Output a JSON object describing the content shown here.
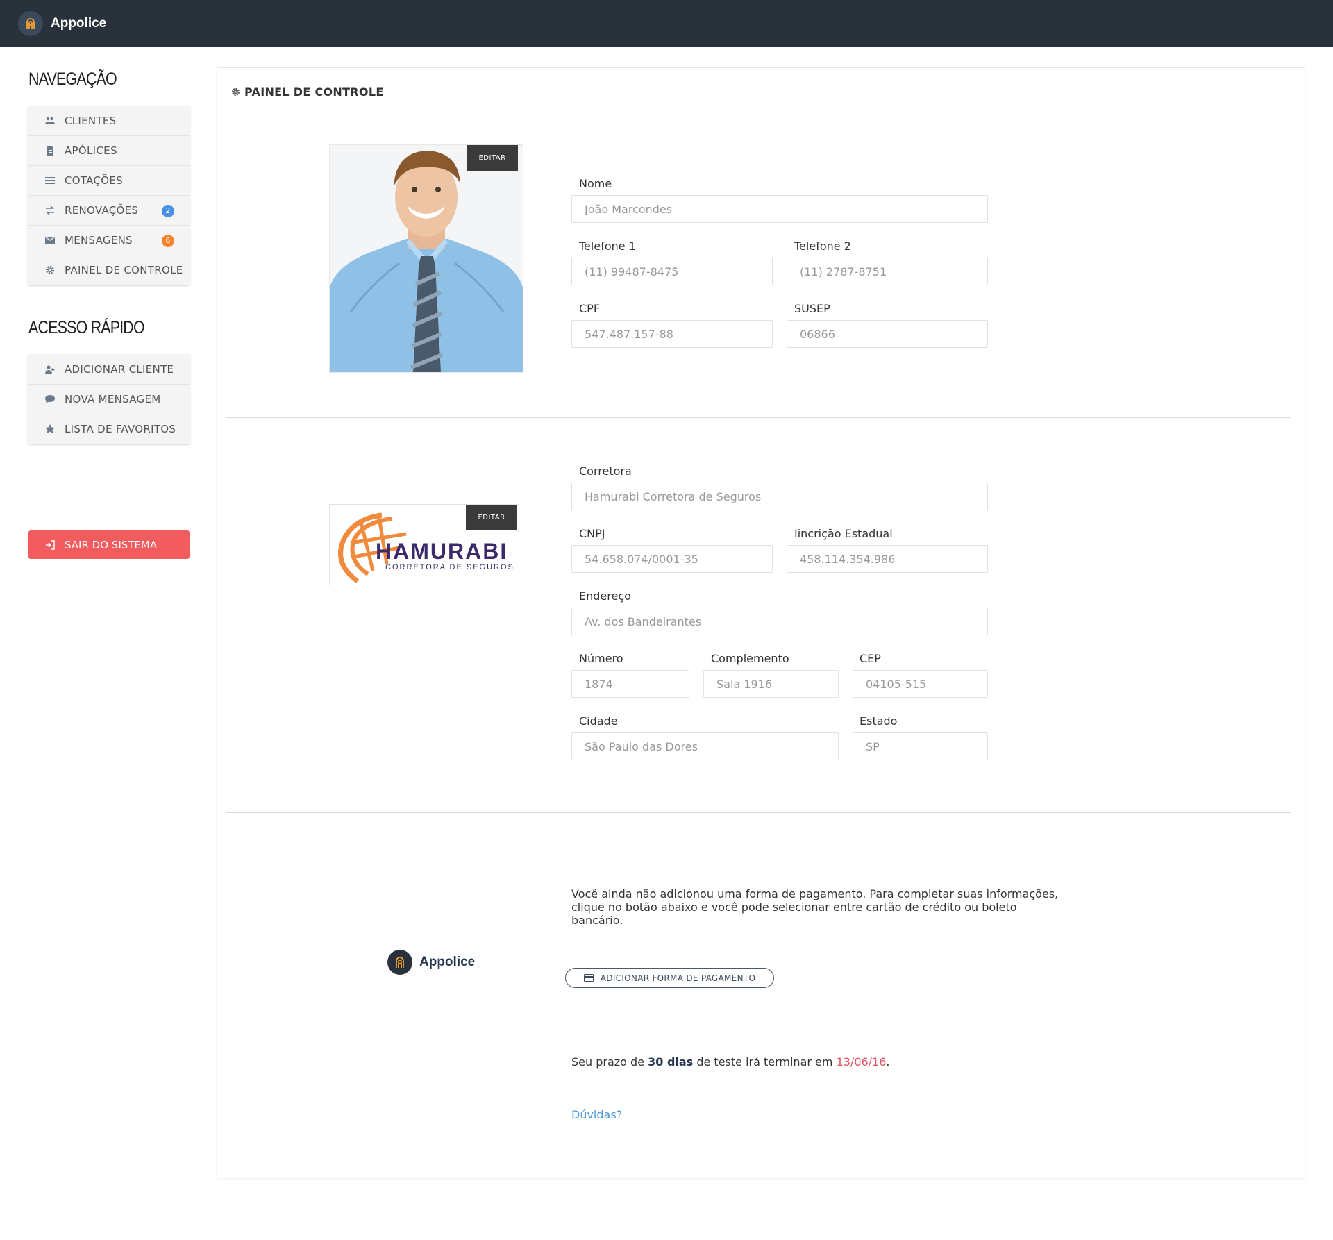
{
  "app": {
    "title": "Appolice"
  },
  "sidebar": {
    "nav_heading": "NAVEGAÇÃO",
    "nav_items": [
      {
        "label": "CLIENTES",
        "icon": "users-icon"
      },
      {
        "label": "APÓLICES",
        "icon": "document-icon"
      },
      {
        "label": "COTAÇÕES",
        "icon": "list-icon"
      },
      {
        "label": "RENOVAÇÕES",
        "icon": "exchange-icon",
        "badge": "2",
        "badge_color": "#4a90e2"
      },
      {
        "label": "MENSAGENS",
        "icon": "envelope-icon",
        "badge": "6",
        "badge_color": "#f5842c"
      },
      {
        "label": "PAINEL DE CONTROLE",
        "icon": "gear-icon"
      }
    ],
    "quick_heading": "ACESSO RÁPIDO",
    "quick_items": [
      {
        "label": "ADICIONAR CLIENTE",
        "icon": "user-plus-icon"
      },
      {
        "label": "NOVA MENSAGEM",
        "icon": "chat-bubble-icon"
      },
      {
        "label": "LISTA DE FAVORITOS",
        "icon": "star-icon"
      }
    ],
    "logout_label": "SAIR DO SISTEMA"
  },
  "panel": {
    "title": "PAINEL DE CONTROLE",
    "edit_label": "EDITAR",
    "profile": {
      "nome_label": "Nome",
      "nome_value": "João Marcondes",
      "tel1_label": "Telefone 1",
      "tel1_value": "(11) 99487-8475",
      "tel2_label": "Telefone 2",
      "tel2_value": "(11) 2787-8751",
      "cpf_label": "CPF",
      "cpf_value": "547.487.157-88",
      "susep_label": "SUSEP",
      "susep_value": "06866"
    },
    "broker": {
      "logo_name": "HAMURABI",
      "logo_tagline": "CORRETORA DE SEGUROS",
      "corretora_label": "Corretora",
      "corretora_value": "Hamurabi Corretora de Seguros",
      "cnpj_label": "CNPJ",
      "cnpj_value": "54.658.074/0001-35",
      "ie_label": "Iincrição Estadual",
      "ie_value": "458.114.354.986",
      "endereco_label": "Endereço",
      "endereco_value": "Av. dos Bandeirantes",
      "numero_label": "Número",
      "numero_value": "1874",
      "complemento_label": "Complemento",
      "complemento_value": "Sala 1916",
      "cep_label": "CEP",
      "cep_value": "04105-515",
      "cidade_label": "Cidade",
      "cidade_value": "São Paulo das Dores",
      "estado_label": "Estado",
      "estado_value": "SP"
    },
    "payment": {
      "info_line1": "Você ainda não adicionou uma forma de pagamento. Para completar suas informações,",
      "info_line2": "clique no botão abaixo e você pode selecionar entre cartão de crédito ou boleto bancário.",
      "button_label": "ADICIONAR FORMA DE PAGAMENTO",
      "trial_prefix": "Seu prazo de",
      "trial_days": "30 dias",
      "trial_middle": "de teste irá terminar em",
      "trial_date": "13/06/16",
      "trial_suffix": ".",
      "help_label": "Dúvidas?"
    }
  },
  "colors": {
    "topbar": "#29313a",
    "logout": "#f25c5f",
    "accent_red": "#e25563",
    "link": "#4d9bd6",
    "brand_orange": "#f08a3c",
    "brand_purple": "#3b2a6b"
  }
}
